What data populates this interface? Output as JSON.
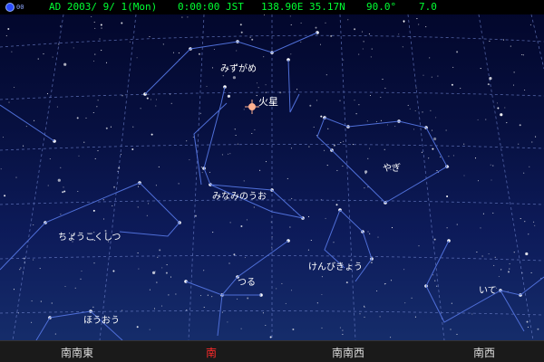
{
  "status": {
    "icon": "moon-phase-icon",
    "icon_sub": "00",
    "date": "AD 2003/ 9/ 1(Mon)",
    "time": "0:00:00 JST",
    "location": "138.90E 35.17N",
    "view_angle": "90.0°",
    "magnitude": "7.0"
  },
  "colors": {
    "sky_top": "#02062a",
    "sky_bottom": "#17306e",
    "grid": "#6b7fc8",
    "constellation_line": "#4f6fd8",
    "status_text": "#00ff33",
    "south_marker": "#ff2a2a",
    "mars": "#ffb090"
  },
  "constellations": [
    {
      "id": "mizugame",
      "label": "みずがめ"
    },
    {
      "id": "yagi",
      "label": "やぎ"
    },
    {
      "id": "minaminouo",
      "label": "みなみのうお"
    },
    {
      "id": "choukokushitsu",
      "label": "ちょうこくしつ"
    },
    {
      "id": "kenbikyou",
      "label": "けんびきょう"
    },
    {
      "id": "tsuru",
      "label": "つる"
    },
    {
      "id": "houou",
      "label": "ほうおう"
    },
    {
      "id": "ite",
      "label": "いて"
    }
  ],
  "planets": [
    {
      "id": "mars",
      "label": "火星"
    }
  ],
  "directions": [
    {
      "label": "南南東",
      "active": false
    },
    {
      "label": "南",
      "active": true
    },
    {
      "label": "南南西",
      "active": false
    },
    {
      "label": "南西",
      "active": false
    }
  ]
}
